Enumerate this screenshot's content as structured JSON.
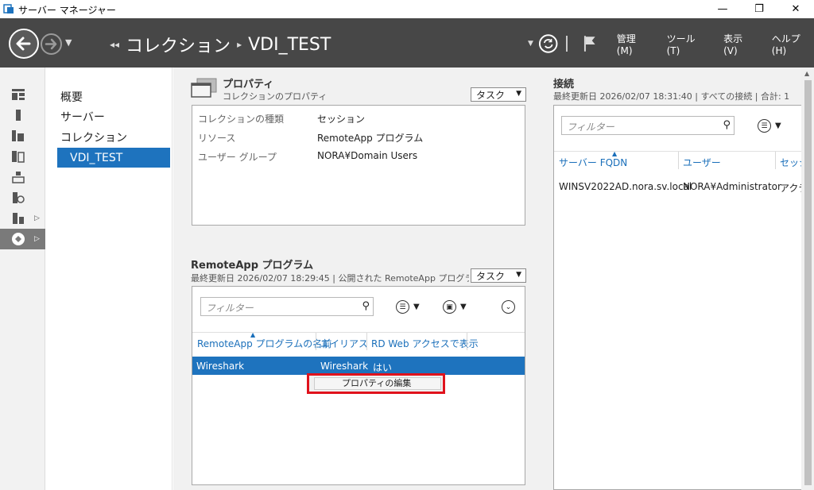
{
  "window": {
    "title": "サーバー マネージャー",
    "minimize": "—",
    "maximize": "❐",
    "close": "✕"
  },
  "header": {
    "breadcrumb": [
      "コレクション",
      "VDI_TEST"
    ],
    "menu": [
      "管理(M)",
      "ツール(T)",
      "表示(V)",
      "ヘルプ(H)"
    ]
  },
  "nav": {
    "items": [
      "概要",
      "サーバー",
      "コレクション",
      "VDI_TEST"
    ],
    "selected": "VDI_TEST"
  },
  "properties": {
    "title": "プロパティ",
    "subtitle": "コレクションのプロパティ",
    "task": "タスク",
    "rows": [
      {
        "key": "コレクションの種類",
        "value": "セッション"
      },
      {
        "key": "リソース",
        "value": "RemoteApp プログラム"
      },
      {
        "key": "ユーザー グループ",
        "value": "NORA¥Domain Users"
      }
    ]
  },
  "remoteapp": {
    "title": "RemoteApp プログラム",
    "subtitle": "最終更新日 2026/02/07 18:29:45 | 公開された RemoteApp プログラ...",
    "task": "タスク",
    "filter_placeholder": "フィルター",
    "columns": [
      "RemoteApp プログラムの名前",
      "エイリアス",
      "RD Web アクセスで表示"
    ],
    "row": {
      "name": "Wireshark",
      "alias": "Wireshark",
      "show": "はい"
    },
    "context_menu": "プロパティの編集"
  },
  "connections": {
    "title": "接続",
    "subtitle": "最終更新日 2026/02/07 18:31:40 | すべての接続 | 合計: 1",
    "filter_placeholder": "フィルター",
    "columns": [
      "サーバー FQDN",
      "ユーザー",
      "セッシ"
    ],
    "row": {
      "fqdn": "WINSV2022AD.nora.sv.local",
      "user": "NORA¥Administrator",
      "state": "アクテ"
    }
  }
}
